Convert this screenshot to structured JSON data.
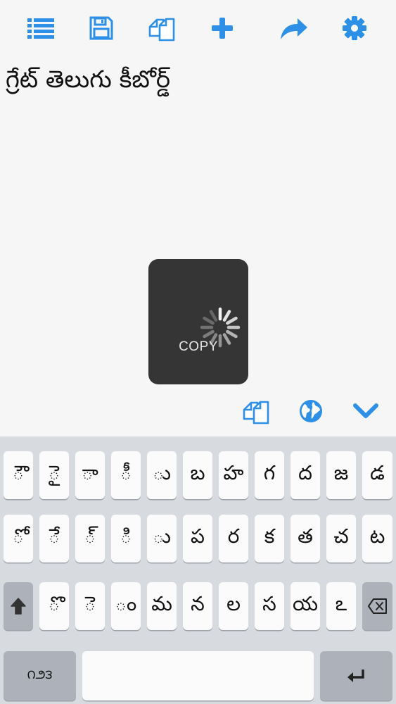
{
  "toolbar": {
    "icons": [
      "list-icon",
      "save-icon",
      "copy-icon",
      "plus-icon",
      "share-icon",
      "gear-icon"
    ],
    "accent_color": "#2e8fe6"
  },
  "editor": {
    "text": "గ్రేట్ తెలుగు కీబోర్డ్"
  },
  "toast": {
    "label": "COPY"
  },
  "aux_bar": {
    "icons": [
      "copy-icon",
      "globe-icon",
      "chevron-down-icon"
    ]
  },
  "keyboard": {
    "row1": [
      "◌ౌ",
      "◌ై",
      "◌ా",
      "◌ీ",
      "◌ు",
      "బ",
      "హ",
      "గ",
      "ద",
      "జ",
      "డ"
    ],
    "row2": [
      "◌ో",
      "◌ే",
      "◌్",
      "◌ి",
      "◌ు",
      "ప",
      "ర",
      "క",
      "త",
      "చ",
      "ట"
    ],
    "row3": [
      "◌ొ",
      "◌ె",
      "ం",
      "మ",
      "న",
      "ల",
      "స",
      "య",
      "ఽ"
    ],
    "mode_key": "౧౨౩",
    "space_label": "",
    "shift_icon": "shift-arrow-icon",
    "backspace_icon": "backspace-icon",
    "return_icon": "return-icon"
  }
}
